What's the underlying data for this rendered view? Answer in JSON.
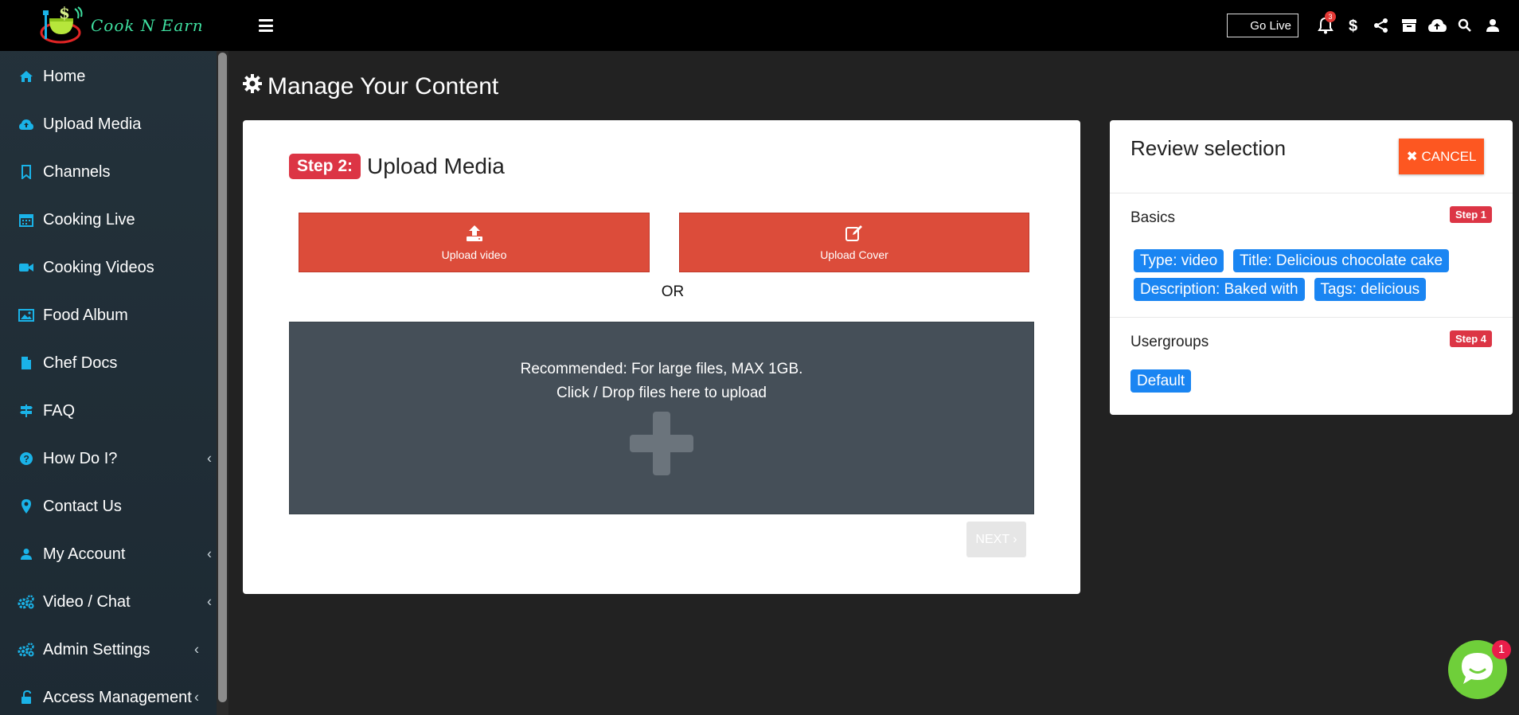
{
  "app": {
    "logo_text": "Cook N Earn"
  },
  "sidebar": {
    "items": [
      {
        "label": "Home",
        "icon": "home-icon",
        "chevron": false
      },
      {
        "label": "Upload Media",
        "icon": "cloud-upload-icon",
        "chevron": false
      },
      {
        "label": "Channels",
        "icon": "bookmark-icon",
        "chevron": false
      },
      {
        "label": "Cooking Live",
        "icon": "calendar-icon",
        "chevron": false
      },
      {
        "label": "Cooking Videos",
        "icon": "video-camera-icon",
        "chevron": false
      },
      {
        "label": "Food Album",
        "icon": "image-icon",
        "chevron": false
      },
      {
        "label": "Chef Docs",
        "icon": "file-icon",
        "chevron": false
      },
      {
        "label": "FAQ",
        "icon": "signpost-icon",
        "chevron": false
      },
      {
        "label": "How Do I?",
        "icon": "question-circle-icon",
        "chevron": true
      },
      {
        "label": "Contact Us",
        "icon": "map-marker-icon",
        "chevron": false
      },
      {
        "label": "My Account",
        "icon": "user-icon",
        "chevron": true
      },
      {
        "label": "Video / Chat",
        "icon": "cogs-icon",
        "chevron": true
      },
      {
        "label": "Admin Settings",
        "icon": "cogs-icon",
        "chevron": true
      },
      {
        "label": "Access Management",
        "icon": "unlock-icon",
        "chevron": true
      }
    ],
    "chevron_glyph": "‹"
  },
  "topbar": {
    "go_live_label": "Go Live",
    "notification_count": "3"
  },
  "page": {
    "title": "Manage Your Content"
  },
  "upload": {
    "step_label": "Step 2:",
    "step_title": "Upload Media",
    "upload_video_label": "Upload video",
    "upload_cover_label": "Upload Cover",
    "or_text": "OR",
    "dropzone_line1": "Recommended: For large files, MAX 1GB.",
    "dropzone_line2": "Click / Drop files here to upload",
    "next_label": "NEXT ›"
  },
  "review": {
    "title": "Review selection",
    "cancel_label": "✖ CANCEL",
    "basics": {
      "name": "Basics",
      "step_badge": "Step 1",
      "tags": [
        "Type: video",
        "Title: Delicious chocolate cake",
        "Description: Baked with",
        "Tags: delicious"
      ]
    },
    "usergroups": {
      "name": "Usergroups",
      "step_badge": "Step 4",
      "tags": [
        "Default"
      ]
    }
  },
  "chat": {
    "badge_count": "1"
  },
  "colors": {
    "accent_cyan": "#1ab3e8",
    "upload_red": "#dc4c3a",
    "step_red": "#dc3545",
    "tag_blue": "#1a85f2",
    "cancel_orange": "#fd5721",
    "chat_green": "#6fcf3a"
  }
}
